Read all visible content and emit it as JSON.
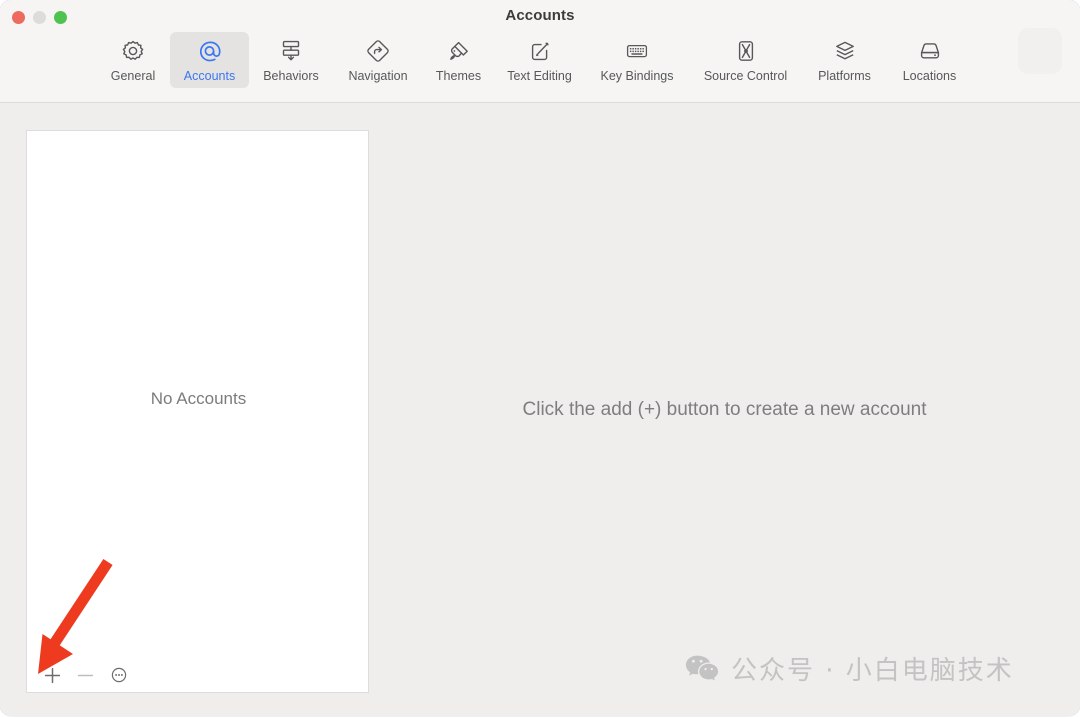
{
  "window": {
    "title": "Accounts",
    "traffic_lights": [
      {
        "name": "close",
        "color": "#ec6a5e"
      },
      {
        "name": "minimize",
        "color": "#dddcda"
      },
      {
        "name": "zoom",
        "color": "#4fc34f"
      }
    ]
  },
  "toolbar": {
    "selected": "Accounts",
    "accent_color": "#3c76f0",
    "tabs": [
      {
        "label": "General",
        "icon": "gear-icon",
        "selected": false
      },
      {
        "label": "Accounts",
        "icon": "at-sign-icon",
        "selected": true
      },
      {
        "label": "Behaviors",
        "icon": "behaviors-icon",
        "selected": false
      },
      {
        "label": "Navigation",
        "icon": "navigation-sign-icon",
        "selected": false
      },
      {
        "label": "Themes",
        "icon": "paintbrush-icon",
        "selected": false
      },
      {
        "label": "Text Editing",
        "icon": "pencil-square-icon",
        "selected": false
      },
      {
        "label": "Key Bindings",
        "icon": "keyboard-icon",
        "selected": false
      },
      {
        "label": "Source Control",
        "icon": "source-control-icon",
        "selected": false
      },
      {
        "label": "Platforms",
        "icon": "layers-icon",
        "selected": false
      },
      {
        "label": "Locations",
        "icon": "hard-drive-icon",
        "selected": false
      }
    ]
  },
  "accounts_pane": {
    "list_empty_label": "No Accounts",
    "detail_message": "Click the add (+) button to create a new account",
    "bottom_buttons": [
      {
        "name": "add",
        "glyph": "+",
        "enabled": true
      },
      {
        "name": "remove",
        "glyph": "−",
        "enabled": false
      },
      {
        "name": "options",
        "glyph": "⋯",
        "enabled": true
      }
    ]
  },
  "annotation": {
    "type": "arrow",
    "color": "#ee3b1f",
    "points_to": "add-button"
  },
  "watermark": {
    "icon": "wechat-icon",
    "text": "公众号 · 小白电脑技术",
    "color": "#c3c3c3"
  }
}
